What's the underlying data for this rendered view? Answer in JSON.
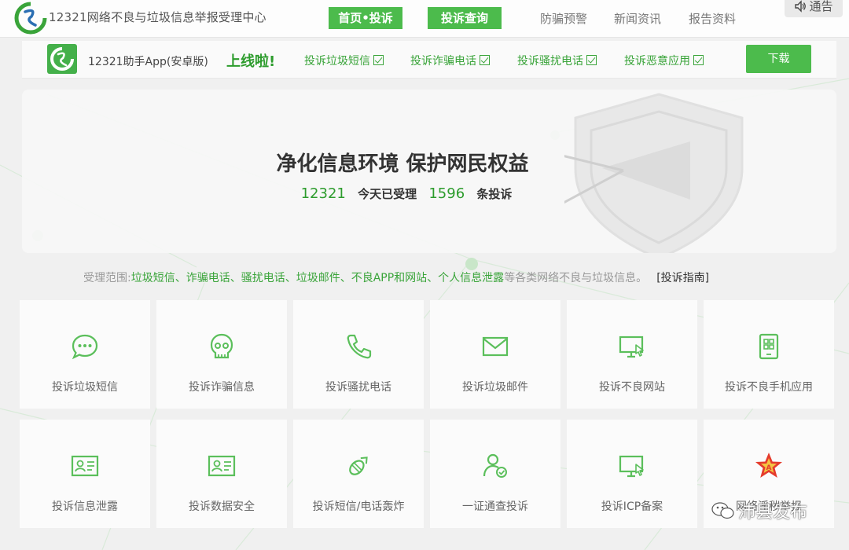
{
  "header": {
    "site_title": "12321网络不良与垃圾信息举报受理中心",
    "nav_primary": [
      "首页•投诉",
      "投诉查询"
    ],
    "nav_links": [
      "防骗预警",
      "新闻资讯",
      "报告资料"
    ],
    "notice_label": "通告"
  },
  "app_banner": {
    "app_name": "12321助手App(安卓版)",
    "online_text": "上线啦!",
    "features": [
      "投诉垃圾短信",
      "投诉诈骗电话",
      "投诉骚扰电话",
      "投诉恶意应用"
    ],
    "download_label": "下载"
  },
  "hero": {
    "slogan": "净化信息环境 保护网民权益",
    "hotline": "12321",
    "accepted_text": "今天已受理",
    "count": "1596",
    "unit_text": "条投诉"
  },
  "scope": {
    "prefix": "受理范围:",
    "items": "垃圾短信、诈骗电话、骚扰电话、垃圾邮件、不良APP和网站、个人信息泄露",
    "suffix": "等各类网络不良与垃圾信息。",
    "guide_link": "[投诉指南]"
  },
  "tiles": [
    {
      "label": "投诉垃圾短信",
      "icon": "chat-bubble-icon"
    },
    {
      "label": "投诉诈骗信息",
      "icon": "skull-icon"
    },
    {
      "label": "投诉骚扰电话",
      "icon": "phone-icon"
    },
    {
      "label": "投诉垃圾邮件",
      "icon": "envelope-icon"
    },
    {
      "label": "投诉不良网站",
      "icon": "monitor-cursor-icon"
    },
    {
      "label": "投诉不良手机应用",
      "icon": "mobile-apps-icon"
    },
    {
      "label": "投诉信息泄露",
      "icon": "id-card-icon"
    },
    {
      "label": "投诉数据安全",
      "icon": "id-card-icon"
    },
    {
      "label": "投诉短信/电话轰炸",
      "icon": "bomb-icon"
    },
    {
      "label": "一证通查投诉",
      "icon": "user-check-icon"
    },
    {
      "label": "投诉ICP备案",
      "icon": "monitor-cursor-icon"
    },
    {
      "label": "网络淫秽举报",
      "icon": "army-star-icon"
    }
  ],
  "watermark": {
    "text": "沛县发布"
  },
  "colors": {
    "brand_green": "#4cbb4c",
    "text_green": "#3aa43a",
    "dark_green": "#2d9c2d"
  }
}
